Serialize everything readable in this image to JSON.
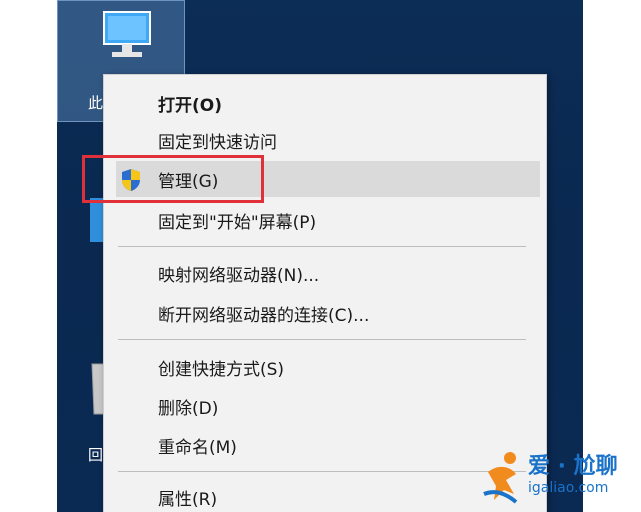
{
  "desktop": {
    "icon1_label": "此",
    "icon3_label": "回"
  },
  "context_menu": {
    "items": [
      {
        "label": "打开(O)",
        "bold": true
      },
      {
        "label": "固定到快速访问"
      },
      {
        "label": "管理(G)",
        "icon": "uac-shield-icon",
        "highlighted": true
      },
      {
        "label": "固定到\"开始\"屏幕(P)"
      },
      {
        "label": "映射网络驱动器(N)..."
      },
      {
        "label": "断开网络驱动器的连接(C)..."
      },
      {
        "label": "创建快捷方式(S)"
      },
      {
        "label": "删除(D)"
      },
      {
        "label": "重命名(M)"
      },
      {
        "label": "属性(R)"
      }
    ]
  },
  "annotation": {
    "color": "#e0313b"
  },
  "watermark": {
    "title": "爱 · 尬聊",
    "url": "igaliao.com"
  }
}
